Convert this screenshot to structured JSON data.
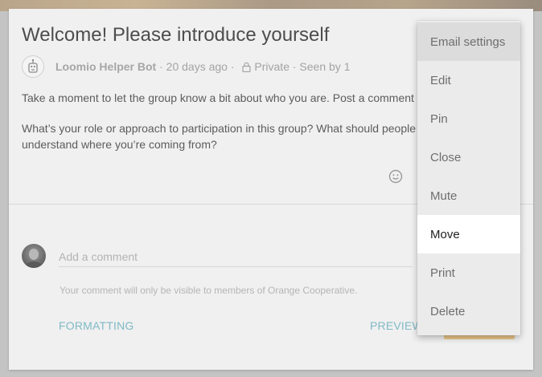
{
  "thread": {
    "title": "Welcome! Please introduce yourself",
    "author": "Loomio Helper Bot",
    "meta_rest": " · 20 days ago · ",
    "privacy": "Private",
    "seen": " · Seen by 1",
    "paragraph_1": "Take a moment to let the group know a bit about who you are. Post a comment",
    "paragraph_2": "What’s your role or approach to participation in this group? What should people understand where you’re coming from?"
  },
  "comment_form": {
    "placeholder": "Add a comment",
    "visibility_note": "Your comment will only be visible to members of Orange Cooperative.",
    "formatting_label": "FORMATTING",
    "preview_label": "PREVIEW"
  },
  "context_menu": {
    "items": [
      {
        "label": "Email settings"
      },
      {
        "label": "Edit"
      },
      {
        "label": "Pin"
      },
      {
        "label": "Close"
      },
      {
        "label": "Mute"
      },
      {
        "label": "Move"
      },
      {
        "label": "Print"
      },
      {
        "label": "Delete"
      }
    ],
    "highlighted_item": "Email settings",
    "active_item": "Move"
  },
  "icons": [
    "bot-avatar-icon",
    "lock-icon",
    "emoji-icon",
    "user-avatar"
  ],
  "colors": {
    "accent": "#7fb9c6",
    "post_button": "#e9c689",
    "card": "#f0f0f0",
    "menu": "#ebebeb"
  }
}
